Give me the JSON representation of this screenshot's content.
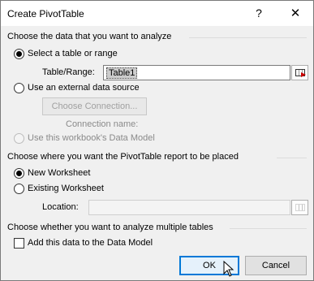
{
  "window": {
    "title": "Create PivotTable",
    "help_label": "?",
    "close_label": "✕"
  },
  "data_section": {
    "heading": "Choose the data that you want to analyze",
    "select_table_label": "Select a table or range",
    "table_range_label": "Table/Range:",
    "table_range_value": "Table1",
    "external_label": "Use an external data source",
    "choose_connection_label": "Choose Connection...",
    "connection_name_label": "Connection name:",
    "data_model_label": "Use this workbook's Data Model"
  },
  "placement_section": {
    "heading": "Choose where you want the PivotTable report to be placed",
    "new_worksheet_label": "New Worksheet",
    "existing_worksheet_label": "Existing Worksheet",
    "location_label": "Location:",
    "location_value": ""
  },
  "multiple_section": {
    "heading": "Choose whether you want to analyze multiple tables",
    "add_data_model_label": "Add this data to the Data Model"
  },
  "buttons": {
    "ok_label": "OK",
    "cancel_label": "Cancel"
  },
  "icons": [
    "help-icon",
    "close-icon",
    "range-selector-icon",
    "mouse-pointer-icon"
  ]
}
